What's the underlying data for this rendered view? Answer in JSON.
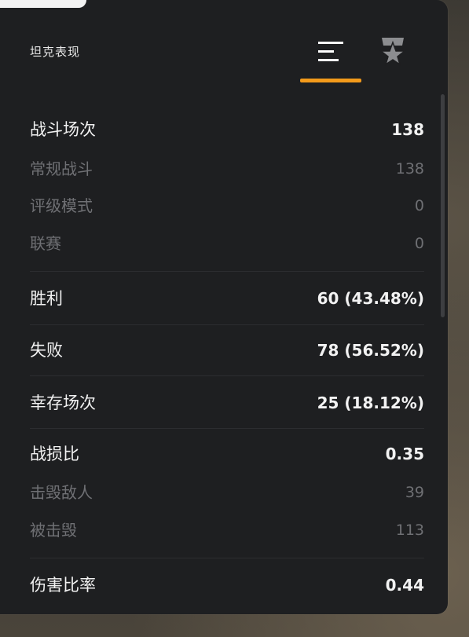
{
  "header": {
    "title": "坦克表现",
    "tabs": [
      {
        "name": "stats",
        "icon": "bars-icon",
        "active": true,
        "accent": "#f39a1b"
      },
      {
        "name": "badge",
        "icon": "star-badge-icon",
        "active": false
      }
    ]
  },
  "stats": {
    "battles": {
      "label": "战斗场次",
      "value": "138"
    },
    "regular": {
      "label": "常规战斗",
      "value": "138"
    },
    "ranked": {
      "label": "评级模式",
      "value": "0"
    },
    "league": {
      "label": "联赛",
      "value": "0"
    },
    "wins": {
      "label": "胜利",
      "value": "60 (43.48%)"
    },
    "losses": {
      "label": "失败",
      "value": "78 (56.52%)"
    },
    "survived": {
      "label": "幸存场次",
      "value": "25 (18.12%)"
    },
    "kd": {
      "label": "战损比",
      "value": "0.35"
    },
    "kills": {
      "label": "击毁敌人",
      "value": "39"
    },
    "deaths": {
      "label": "被击毁",
      "value": "113"
    },
    "damage_ratio": {
      "label": "伤害比率",
      "value": "0.44"
    }
  }
}
